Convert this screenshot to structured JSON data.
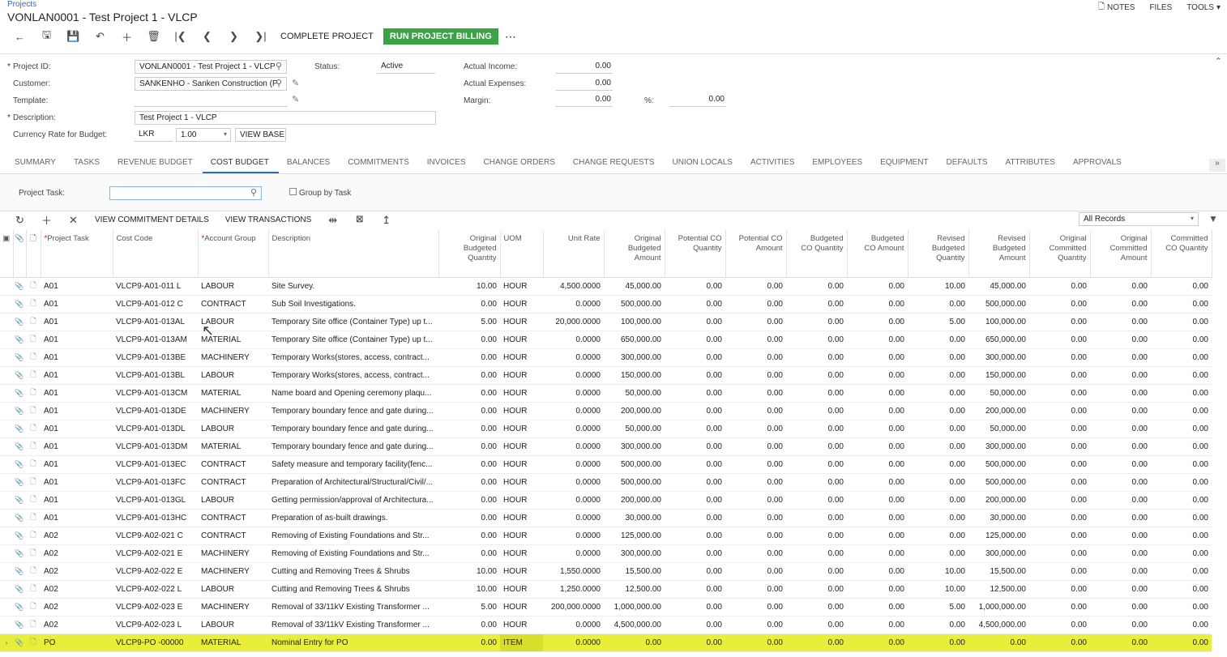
{
  "breadcrumb": "Projects",
  "title": "VONLAN0001 - Test Project 1 - VLCP",
  "top_links": {
    "notes": "NOTES",
    "files": "FILES",
    "tools": "TOOLS"
  },
  "toolbar": {
    "complete": "COMPLETE PROJECT",
    "billing": "RUN PROJECT BILLING",
    "more": "⋯"
  },
  "form": {
    "project_id_label": "Project ID:",
    "project_id": "VONLAN0001 - Test Project 1 - VLCP",
    "customer_label": "Customer:",
    "customer": "SANKENHO - Sanken Construction (P",
    "template_label": "Template:",
    "template": "",
    "description_label": "Description:",
    "description": "Test Project 1 - VLCP",
    "currency_label": "Currency Rate for Budget:",
    "currency": "LKR",
    "rate": "1.00",
    "view_base": "VIEW BASE",
    "status_label": "Status:",
    "status": "Active",
    "actual_income_label": "Actual Income:",
    "actual_income": "0.00",
    "actual_expenses_label": "Actual Expenses:",
    "actual_expenses": "0.00",
    "margin_label": "Margin:",
    "margin": "0.00",
    "pct_label": "%:",
    "pct": "0.00"
  },
  "tabs": [
    "SUMMARY",
    "TASKS",
    "REVENUE BUDGET",
    "COST BUDGET",
    "BALANCES",
    "COMMITMENTS",
    "INVOICES",
    "CHANGE ORDERS",
    "CHANGE REQUESTS",
    "UNION LOCALS",
    "ACTIVITIES",
    "EMPLOYEES",
    "EQUIPMENT",
    "DEFAULTS",
    "ATTRIBUTES",
    "APPROVALS"
  ],
  "filter": {
    "project_task_label": "Project Task:",
    "project_task": "",
    "group_by_task": "Group by Task",
    "records": "All Records"
  },
  "grid_toolbar": {
    "view_commitment": "VIEW COMMITMENT DETAILS",
    "view_transactions": "VIEW TRANSACTIONS"
  },
  "columns": {
    "task": "Project Task",
    "cost_code": "Cost Code",
    "account_group": "Account Group",
    "description": "Description",
    "orig_qty": [
      "Original",
      "Budgeted",
      "Quantity"
    ],
    "uom": "UOM",
    "unit_rate": "Unit Rate",
    "orig_amt": [
      "Original",
      "Budgeted",
      "Amount"
    ],
    "pot_co_qty": [
      "Potential CO",
      "Quantity"
    ],
    "pot_co_amt": [
      "Potential CO",
      "Amount"
    ],
    "bud_co_qty": [
      "Budgeted",
      "CO Quantity"
    ],
    "bud_co_amt": [
      "Budgeted",
      "CO Amount"
    ],
    "rev_qty": [
      "Revised",
      "Budgeted",
      "Quantity"
    ],
    "rev_amt": [
      "Revised",
      "Budgeted",
      "Amount"
    ],
    "orig_com_qty": [
      "Original",
      "Committed",
      "Quantity"
    ],
    "orig_com_amt": [
      "Original",
      "Committed",
      "Amount"
    ],
    "com_co_qty": [
      "Committed",
      "CO Quantity"
    ]
  },
  "rows": [
    [
      "A01",
      "VLCP9-A01-011 L",
      "LABOUR",
      "Site Survey.",
      "10.00",
      "HOUR",
      "4,500.0000",
      "45,000.00",
      "0.00",
      "0.00",
      "0.00",
      "0.00",
      "10.00",
      "45,000.00",
      "0.00",
      "0.00",
      "0.00"
    ],
    [
      "A01",
      "VLCP9-A01-012 C",
      "CONTRACT",
      "Sub Soil Investigations.",
      "0.00",
      "HOUR",
      "0.0000",
      "500,000.00",
      "0.00",
      "0.00",
      "0.00",
      "0.00",
      "0.00",
      "500,000.00",
      "0.00",
      "0.00",
      "0.00"
    ],
    [
      "A01",
      "VLCP9-A01-013AL",
      "LABOUR",
      "Temporary Site office (Container Type) up t...",
      "5.00",
      "HOUR",
      "20,000.0000",
      "100,000.00",
      "0.00",
      "0.00",
      "0.00",
      "0.00",
      "5.00",
      "100,000.00",
      "0.00",
      "0.00",
      "0.00"
    ],
    [
      "A01",
      "VLCP9-A01-013AM",
      "MATERIAL",
      "Temporary Site office (Container Type) up t...",
      "0.00",
      "HOUR",
      "0.0000",
      "650,000.00",
      "0.00",
      "0.00",
      "0.00",
      "0.00",
      "0.00",
      "650,000.00",
      "0.00",
      "0.00",
      "0.00"
    ],
    [
      "A01",
      "VLCP9-A01-013BE",
      "MACHINERY",
      "Temporary Works(stores, access, contract...",
      "0.00",
      "HOUR",
      "0.0000",
      "300,000.00",
      "0.00",
      "0.00",
      "0.00",
      "0.00",
      "0.00",
      "300,000.00",
      "0.00",
      "0.00",
      "0.00"
    ],
    [
      "A01",
      "VLCP9-A01-013BL",
      "LABOUR",
      "Temporary Works(stores, access, contract...",
      "0.00",
      "HOUR",
      "0.0000",
      "150,000.00",
      "0.00",
      "0.00",
      "0.00",
      "0.00",
      "0.00",
      "150,000.00",
      "0.00",
      "0.00",
      "0.00"
    ],
    [
      "A01",
      "VLCP9-A01-013CM",
      "MATERIAL",
      "Name board and Opening ceremony plaqu...",
      "0.00",
      "HOUR",
      "0.0000",
      "50,000.00",
      "0.00",
      "0.00",
      "0.00",
      "0.00",
      "0.00",
      "50,000.00",
      "0.00",
      "0.00",
      "0.00"
    ],
    [
      "A01",
      "VLCP9-A01-013DE",
      "MACHINERY",
      "Temporary boundary fence and gate during...",
      "0.00",
      "HOUR",
      "0.0000",
      "200,000.00",
      "0.00",
      "0.00",
      "0.00",
      "0.00",
      "0.00",
      "200,000.00",
      "0.00",
      "0.00",
      "0.00"
    ],
    [
      "A01",
      "VLCP9-A01-013DL",
      "LABOUR",
      "Temporary boundary fence and gate during...",
      "0.00",
      "HOUR",
      "0.0000",
      "50,000.00",
      "0.00",
      "0.00",
      "0.00",
      "0.00",
      "0.00",
      "50,000.00",
      "0.00",
      "0.00",
      "0.00"
    ],
    [
      "A01",
      "VLCP9-A01-013DM",
      "MATERIAL",
      "Temporary boundary fence and gate during...",
      "0.00",
      "HOUR",
      "0.0000",
      "300,000.00",
      "0.00",
      "0.00",
      "0.00",
      "0.00",
      "0.00",
      "300,000.00",
      "0.00",
      "0.00",
      "0.00"
    ],
    [
      "A01",
      "VLCP9-A01-013EC",
      "CONTRACT",
      "Safety measure and temporary facility(fenc...",
      "0.00",
      "HOUR",
      "0.0000",
      "500,000.00",
      "0.00",
      "0.00",
      "0.00",
      "0.00",
      "0.00",
      "500,000.00",
      "0.00",
      "0.00",
      "0.00"
    ],
    [
      "A01",
      "VLCP9-A01-013FC",
      "CONTRACT",
      "Preparation of Architectural/Structural/Civil/...",
      "0.00",
      "HOUR",
      "0.0000",
      "500,000.00",
      "0.00",
      "0.00",
      "0.00",
      "0.00",
      "0.00",
      "500,000.00",
      "0.00",
      "0.00",
      "0.00"
    ],
    [
      "A01",
      "VLCP9-A01-013GL",
      "LABOUR",
      "Getting permission/approval of Architectura...",
      "0.00",
      "HOUR",
      "0.0000",
      "200,000.00",
      "0.00",
      "0.00",
      "0.00",
      "0.00",
      "0.00",
      "200,000.00",
      "0.00",
      "0.00",
      "0.00"
    ],
    [
      "A01",
      "VLCP9-A01-013HC",
      "CONTRACT",
      "Preparation of as-built drawings.",
      "0.00",
      "HOUR",
      "0.0000",
      "30,000.00",
      "0.00",
      "0.00",
      "0.00",
      "0.00",
      "0.00",
      "30,000.00",
      "0.00",
      "0.00",
      "0.00"
    ],
    [
      "A02",
      "VLCP9-A02-021 C",
      "CONTRACT",
      "Removing of Existing Foundations and Str...",
      "0.00",
      "HOUR",
      "0.0000",
      "125,000.00",
      "0.00",
      "0.00",
      "0.00",
      "0.00",
      "0.00",
      "125,000.00",
      "0.00",
      "0.00",
      "0.00"
    ],
    [
      "A02",
      "VLCP9-A02-021 E",
      "MACHINERY",
      "Removing of Existing Foundations and Str...",
      "0.00",
      "HOUR",
      "0.0000",
      "300,000.00",
      "0.00",
      "0.00",
      "0.00",
      "0.00",
      "0.00",
      "300,000.00",
      "0.00",
      "0.00",
      "0.00"
    ],
    [
      "A02",
      "VLCP9-A02-022 E",
      "MACHINERY",
      "Cutting and Removing Trees & Shrubs",
      "10.00",
      "HOUR",
      "1,550.0000",
      "15,500.00",
      "0.00",
      "0.00",
      "0.00",
      "0.00",
      "10.00",
      "15,500.00",
      "0.00",
      "0.00",
      "0.00"
    ],
    [
      "A02",
      "VLCP9-A02-022 L",
      "LABOUR",
      "Cutting and Removing Trees & Shrubs",
      "10.00",
      "HOUR",
      "1,250.0000",
      "12,500.00",
      "0.00",
      "0.00",
      "0.00",
      "0.00",
      "10.00",
      "12,500.00",
      "0.00",
      "0.00",
      "0.00"
    ],
    [
      "A02",
      "VLCP9-A02-023 E",
      "MACHINERY",
      "Removal of 33/11kV Existing Transformer ...",
      "5.00",
      "HOUR",
      "200,000.0000",
      "1,000,000.00",
      "0.00",
      "0.00",
      "0.00",
      "0.00",
      "5.00",
      "1,000,000.00",
      "0.00",
      "0.00",
      "0.00"
    ],
    [
      "A02",
      "VLCP9-A02-023 L",
      "LABOUR",
      "Removal of 33/11kV Existing Transformer ...",
      "0.00",
      "HOUR",
      "0.0000",
      "4,500,000.00",
      "0.00",
      "0.00",
      "0.00",
      "0.00",
      "0.00",
      "4,500,000.00",
      "0.00",
      "0.00",
      "0.00"
    ],
    [
      "PO",
      "VLCP9-PO -00000",
      "MATERIAL",
      "Nominal Entry for PO",
      "0.00",
      "ITEM",
      "0.0000",
      "0.00",
      "0.00",
      "0.00",
      "0.00",
      "0.00",
      "0.00",
      "0.00",
      "0.00",
      "0.00",
      "0.00"
    ]
  ],
  "selected_row": 20
}
